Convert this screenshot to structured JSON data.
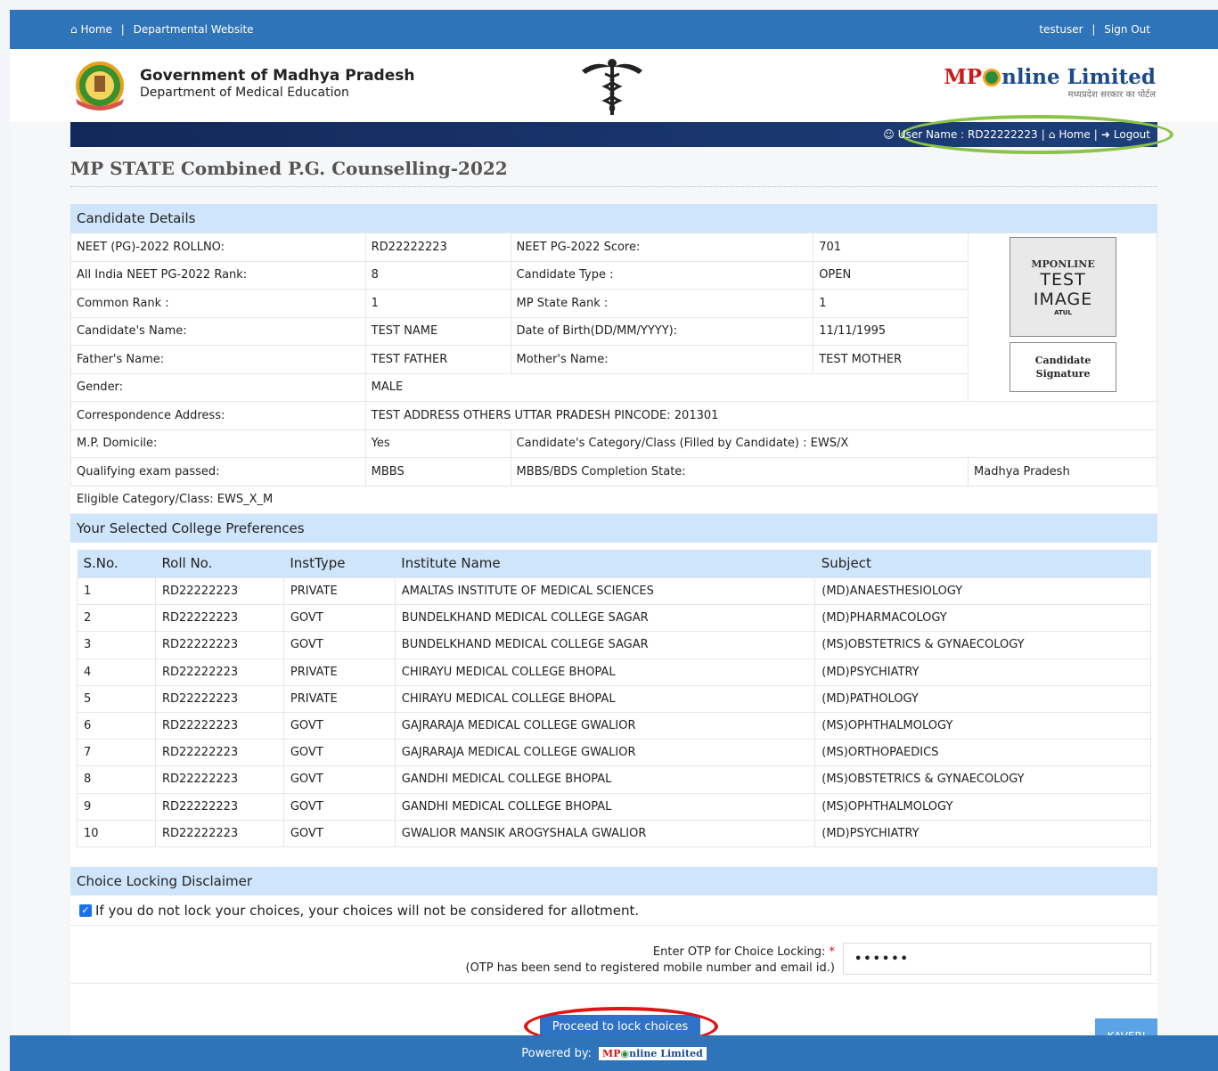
{
  "topbar": {
    "home": "Home",
    "sep": "|",
    "dept_site": "Departmental Website",
    "user": "testuser",
    "sign_out": "Sign Out"
  },
  "header": {
    "gov_line1": "Government of Madhya Pradesh",
    "gov_line2": "Department of Medical Education",
    "mponline_mp": "MP",
    "mponline_rest": "nline Limited",
    "mponline_tag": "मध्यप्रदेश सरकार का पोर्टल"
  },
  "userbar": {
    "label": "User Name : RD22222223",
    "home": "Home",
    "logout": "Logout"
  },
  "page_title": "MP STATE Combined P.G. Counselling-2022",
  "candidate": {
    "heading": "Candidate Details",
    "rows": [
      [
        "NEET (PG)-2022 ROLLNO:",
        "RD22222223",
        "NEET PG-2022 Score:",
        "701"
      ],
      [
        "All India NEET PG-2022 Rank:",
        "8",
        "Candidate Type :",
        "OPEN"
      ],
      [
        "Common Rank :",
        "1",
        "MP State Rank :",
        "1"
      ],
      [
        "Candidate's Name:",
        "TEST NAME",
        "Date of Birth(DD/MM/YYYY):",
        "11/11/1995"
      ],
      [
        "Father's Name:",
        "TEST FATHER",
        "Mother's Name:",
        "TEST MOTHER"
      ]
    ],
    "gender_label": "Gender:",
    "gender": "MALE",
    "address_label": "Correspondence Address:",
    "address": "TEST ADDRESS OTHERS UTTAR PRADESH PINCODE: 201301",
    "domicile_label": "M.P. Domicile:",
    "domicile": "Yes",
    "category_label": "Candidate's Category/Class (Filled by Candidate) : EWS/X",
    "qual_label": "Qualifying exam passed:",
    "qual": "MBBS",
    "completion_label": "MBBS/BDS Completion State:",
    "completion": "Madhya Pradesh",
    "eligible": "Eligible Category/Class: EWS_X_M",
    "photo": {
      "l1": "MPONLINE",
      "l2": "TEST",
      "l3": "IMAGE",
      "l4": "ATUL"
    },
    "signature": "Candidate Signature"
  },
  "preferences": {
    "heading": "Your Selected College Preferences",
    "columns": [
      "S.No.",
      "Roll No.",
      "InstType",
      "Institute Name",
      "Subject"
    ],
    "rows": [
      [
        "1",
        "RD22222223",
        "PRIVATE",
        "AMALTAS INSTITUTE OF MEDICAL SCIENCES",
        "(MD)ANAESTHESIOLOGY"
      ],
      [
        "2",
        "RD22222223",
        "GOVT",
        "BUNDELKHAND MEDICAL COLLEGE SAGAR",
        "(MD)PHARMACOLOGY"
      ],
      [
        "3",
        "RD22222223",
        "GOVT",
        "BUNDELKHAND MEDICAL COLLEGE SAGAR",
        "(MS)OBSTETRICS & GYNAECOLOGY"
      ],
      [
        "4",
        "RD22222223",
        "PRIVATE",
        "CHIRAYU MEDICAL COLLEGE BHOPAL",
        "(MD)PSYCHIATRY"
      ],
      [
        "5",
        "RD22222223",
        "PRIVATE",
        "CHIRAYU MEDICAL COLLEGE BHOPAL",
        "(MD)PATHOLOGY"
      ],
      [
        "6",
        "RD22222223",
        "GOVT",
        "GAJRARAJA MEDICAL COLLEGE GWALIOR",
        "(MS)OPHTHALMOLOGY"
      ],
      [
        "7",
        "RD22222223",
        "GOVT",
        "GAJRARAJA MEDICAL COLLEGE GWALIOR",
        "(MS)ORTHOPAEDICS"
      ],
      [
        "8",
        "RD22222223",
        "GOVT",
        "GANDHI MEDICAL COLLEGE BHOPAL",
        "(MS)OBSTETRICS & GYNAECOLOGY"
      ],
      [
        "9",
        "RD22222223",
        "GOVT",
        "GANDHI MEDICAL COLLEGE BHOPAL",
        "(MS)OPHTHALMOLOGY"
      ],
      [
        "10",
        "RD22222223",
        "GOVT",
        "GWALIOR MANSIK AROGYSHALA GWALIOR",
        "(MD)PSYCHIATRY"
      ]
    ]
  },
  "disclaimer": {
    "heading": "Choice Locking Disclaimer",
    "checkbox_text": "If you do not lock your choices, your choices will not be considered for allotment.",
    "checked": true,
    "otp_label": "Enter OTP for Choice Locking:",
    "otp_required": "*",
    "otp_note": "(OTP has been send to registered mobile number and email id.)",
    "otp_value": "••••••",
    "proceed": "Proceed to lock choices"
  },
  "kaveri": "KAVERI",
  "footer": {
    "powered_by": "Powered by:",
    "logo_mp": "MP",
    "logo_rest": "nline Limited"
  },
  "colors": {
    "topbar": "#2f73b8",
    "section_head": "#cfe5fb",
    "userbar": "#13285a",
    "highlight_green": "#8bc34a",
    "highlight_red": "#e01414",
    "button": "#2f73c8"
  }
}
